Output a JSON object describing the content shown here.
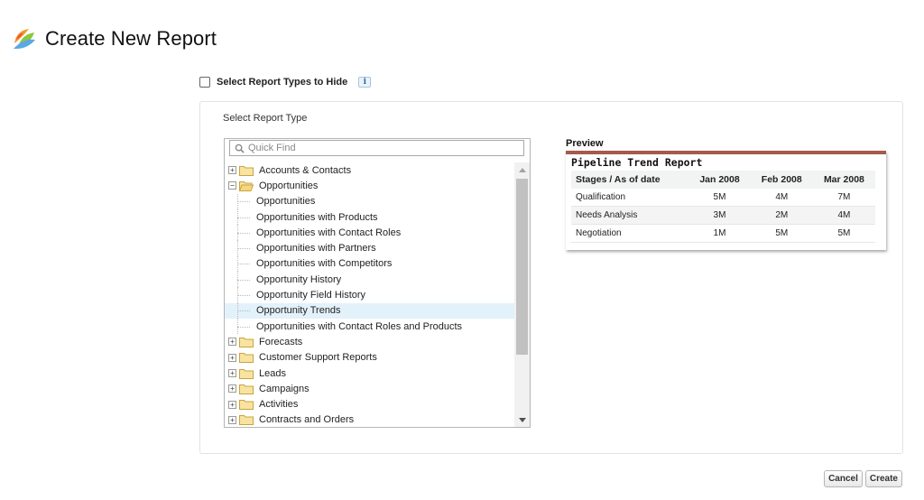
{
  "header": {
    "title": "Create New Report",
    "logo_icon": "salesforce-reports-icon"
  },
  "hide_types": {
    "label": "Select Report Types to Hide",
    "checked": false
  },
  "panel": {
    "label": "Select Report Type"
  },
  "search": {
    "placeholder": "Quick Find"
  },
  "tree": {
    "folders_top": [
      {
        "label": "Accounts & Contacts",
        "expanded": false
      },
      {
        "label": "Opportunities",
        "expanded": true
      }
    ],
    "opportunity_items": [
      "Opportunities",
      "Opportunities with Products",
      "Opportunities with Contact Roles",
      "Opportunities with Partners",
      "Opportunities with Competitors",
      "Opportunity History",
      "Opportunity Field History",
      "Opportunity Trends",
      "Opportunities with Contact Roles and Products"
    ],
    "selected": "Opportunity Trends",
    "folders_bottom": [
      "Forecasts",
      "Customer Support Reports",
      "Leads",
      "Campaigns",
      "Activities",
      "Contracts and Orders"
    ]
  },
  "preview": {
    "label": "Preview",
    "title": "Pipeline Trend Report",
    "columns": [
      "Stages / As of date",
      "Jan 2008",
      "Feb 2008",
      "Mar 2008"
    ],
    "rows": [
      [
        "Qualification",
        "5M",
        "4M",
        "7M"
      ],
      [
        "Needs Analysis",
        "3M",
        "2M",
        "4M"
      ],
      [
        "Negotiation",
        "1M",
        "5M",
        "5M"
      ]
    ]
  },
  "buttons": {
    "cancel": "Cancel",
    "create": "Create"
  },
  "colors": {
    "preview_accent": "#a45a4c",
    "selected_row": "#e3f1fb",
    "folder": "#f3d27a"
  }
}
